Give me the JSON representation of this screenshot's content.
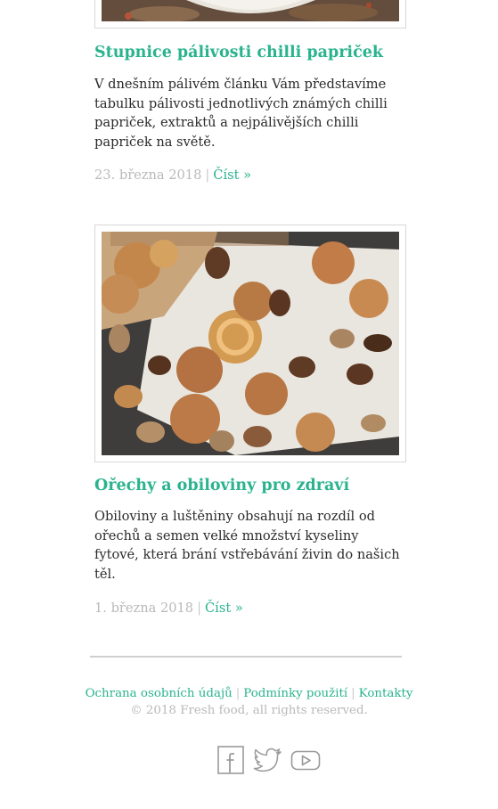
{
  "articles": [
    {
      "title": "Stupnice pálivosti chilli papriček",
      "excerpt": "V dnešním pálivém článku Vám představíme tabulku pálivosti jednotlivých známých chilli papriček, extraktů a nejpálivějších chilli papriček na světě.",
      "date": "23. března 2018",
      "separator": "|",
      "read_more": "Číst »"
    },
    {
      "title": "Ořechy a obiloviny pro zdraví",
      "excerpt": "Obiloviny a luštěniny obsahují na rozdíl od ořechů a semen velké množství kyseliny fytové, která brání vstřebávání živin do našich těl.",
      "date": "1. března 2018",
      "separator": "|",
      "read_more": "Číst »"
    }
  ],
  "footer": {
    "links": [
      "Ochrana osobních údajů",
      "Podmínky použití",
      "Kontakty"
    ],
    "separator": "|",
    "copyright": "© 2018 Fresh food, all rights reserved."
  },
  "social": [
    "facebook-icon",
    "twitter-icon",
    "youtube-icon"
  ],
  "colors": {
    "accent": "#2ab38e",
    "text": "#2b2b2b",
    "muted": "#b9b9b9",
    "border": "#d7d7d7"
  }
}
